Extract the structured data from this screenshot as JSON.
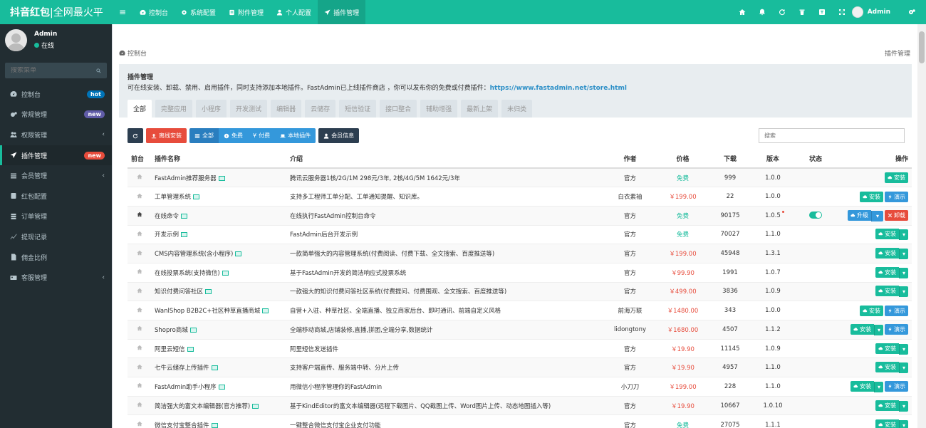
{
  "brand": {
    "name": "抖音红包",
    "slogan": "|全网最火平"
  },
  "topnav": [
    {
      "label": "控制台",
      "icon": "dashboard-icon"
    },
    {
      "label": "系统配置",
      "icon": "gears-icon"
    },
    {
      "label": "附件管理",
      "icon": "attachment-icon"
    },
    {
      "label": "个人配置",
      "icon": "user-icon"
    },
    {
      "label": "插件管理",
      "icon": "rocket-icon"
    }
  ],
  "user": {
    "name": "Admin",
    "status": "在线"
  },
  "sidebar": {
    "search_placeholder": "搜索菜单",
    "items": [
      {
        "label": "控制台",
        "badge": "hot",
        "badge_color": "#0073b7"
      },
      {
        "label": "常规管理",
        "badge": "new",
        "badge_color": "#605ca8"
      },
      {
        "label": "权限管理",
        "chevron": "‹"
      },
      {
        "label": "插件管理",
        "badge": "new",
        "badge_color": "#e74c3c"
      },
      {
        "label": "会员管理",
        "chevron": "‹"
      },
      {
        "label": "红包配置"
      },
      {
        "label": "订单管理"
      },
      {
        "label": "提现记录"
      },
      {
        "label": "佣金比例"
      },
      {
        "label": "客服管理",
        "chevron": "‹"
      }
    ]
  },
  "breadcrumb": {
    "home": "控制台",
    "current": "插件管理"
  },
  "panel": {
    "title": "插件管理",
    "description": "可在线安装、卸载、禁用、启用插件，同时支持添加本地插件。FastAdmin已上线插件商店 ，你可以发布你的免费或付费插件：",
    "link": "https://www.fastadmin.net/store.html"
  },
  "tabs": [
    "全部",
    "完整应用",
    "小程序",
    "开发测试",
    "编辑器",
    "云储存",
    "短信验证",
    "接口整合",
    "辅助增强",
    "最新上架",
    "未归类"
  ],
  "toolbar": {
    "offline_install": "离线安装",
    "all": "全部",
    "free": "免费",
    "paid": "付费",
    "local": "本地插件",
    "member": "会员信息",
    "search_placeholder": "搜索"
  },
  "table": {
    "headers": {
      "front": "前台",
      "name": "插件名称",
      "intro": "介绍",
      "author": "作者",
      "price": "价格",
      "downloads": "下载",
      "version": "版本",
      "status": "状态",
      "ops": "操作"
    },
    "rows": [
      {
        "name": "FastAdmin推荐服务器",
        "intro": "腾讯云服务器1核/2G/1M 298元/3年, 2核/4G/5M 1642元/3年",
        "author": "官方",
        "price": "免费",
        "downloads": "999",
        "version": "1.0.0",
        "btn_type": "install"
      },
      {
        "name": "工单管理系统",
        "intro": "支持多工程师工单分配、工单通知提醒、知识库。",
        "author": "白衣素袖",
        "price": "￥199.00",
        "downloads": "22",
        "version": "1.0.0",
        "btn_type": "install_demo"
      },
      {
        "name": "在线命令",
        "intro": "在线执行FastAdmin控制台命令",
        "author": "官方",
        "price": "免费",
        "downloads": "90175",
        "version": "1.0.5",
        "btn_type": "upgrade",
        "installed": true
      },
      {
        "name": "开发示例",
        "intro": "FastAdmin后台开发示例",
        "author": "官方",
        "price": "免费",
        "downloads": "70027",
        "version": "1.1.0",
        "btn_type": "install_dd"
      },
      {
        "name": "CMS内容管理系统(含小程序)",
        "intro": "一款简单强大的内容管理系统(付费阅读、付费下载、全文搜索、百度推送等)",
        "author": "官方",
        "price": "￥199.00",
        "downloads": "45948",
        "version": "1.3.1",
        "btn_type": "install_dd"
      },
      {
        "name": "在线投票系统(支持微信)",
        "intro": "基于FastAdmin开发的简洁响应式投票系统",
        "author": "官方",
        "price": "￥99.90",
        "downloads": "1991",
        "version": "1.0.7",
        "btn_type": "install_dd"
      },
      {
        "name": "知识付费问答社区",
        "intro": "一款强大的知识付费问答社区系统(付费提问、付费围观、全文搜索、百度推送等)",
        "author": "官方",
        "price": "￥499.00",
        "downloads": "3836",
        "version": "1.0.9",
        "btn_type": "install_dd"
      },
      {
        "name": "WanlShop B2B2C+社区种草直播商城",
        "intro": "自营+入驻、种草社区、全端直播、独立商家后台、即时通讯、前端自定义风格",
        "author": "前海万联",
        "price": "￥1480.00",
        "downloads": "343",
        "version": "1.0.0",
        "btn_type": "install_demo"
      },
      {
        "name": "Shopro商城",
        "intro": "全端移动商城,店铺装修,直播,拼团,全端分享,数据统计",
        "author": "lidongtony",
        "price": "￥1680.00",
        "downloads": "4507",
        "version": "1.1.2",
        "btn_type": "install_dd_demo"
      },
      {
        "name": "阿里云短信",
        "intro": "阿里短信发送插件",
        "author": "官方",
        "price": "￥19.90",
        "downloads": "11145",
        "version": "1.0.9",
        "btn_type": "install_dd"
      },
      {
        "name": "七牛云储存上传插件",
        "intro": "支持客户端直传、服务端中转、分片上传",
        "author": "官方",
        "price": "￥19.90",
        "downloads": "4957",
        "version": "1.1.0",
        "btn_type": "install_dd"
      },
      {
        "name": "FastAdmin助手小程序",
        "intro": "用微信小程序管理你的FastAdmin",
        "author": "小刀刀",
        "price": "￥199.00",
        "downloads": "228",
        "version": "1.1.0",
        "btn_type": "install_dd_demo"
      },
      {
        "name": "简洁强大的富文本编辑器(官方推荐)",
        "intro": "基于KindEditor的富文本编辑器(远程下载图片、QQ截图上传、Word图片上传、动态地图插入等)",
        "author": "官方",
        "price": "￥19.90",
        "downloads": "10667",
        "version": "1.0.10",
        "btn_type": "install_dd"
      },
      {
        "name": "微信支付宝整合插件",
        "intro": "一键整合微信支付宝企业支付功能",
        "author": "官方",
        "price": "免费",
        "downloads": "27075",
        "version": "1.1.1",
        "btn_type": "install_dd"
      }
    ],
    "btn_labels": {
      "install": "安装",
      "demo": "演示",
      "upgrade": "升级",
      "uninstall": "卸载"
    }
  },
  "colors": {
    "primary": "#18bc9c",
    "sidebar": "#222d32",
    "danger": "#e74c3c",
    "info": "#3498db"
  }
}
